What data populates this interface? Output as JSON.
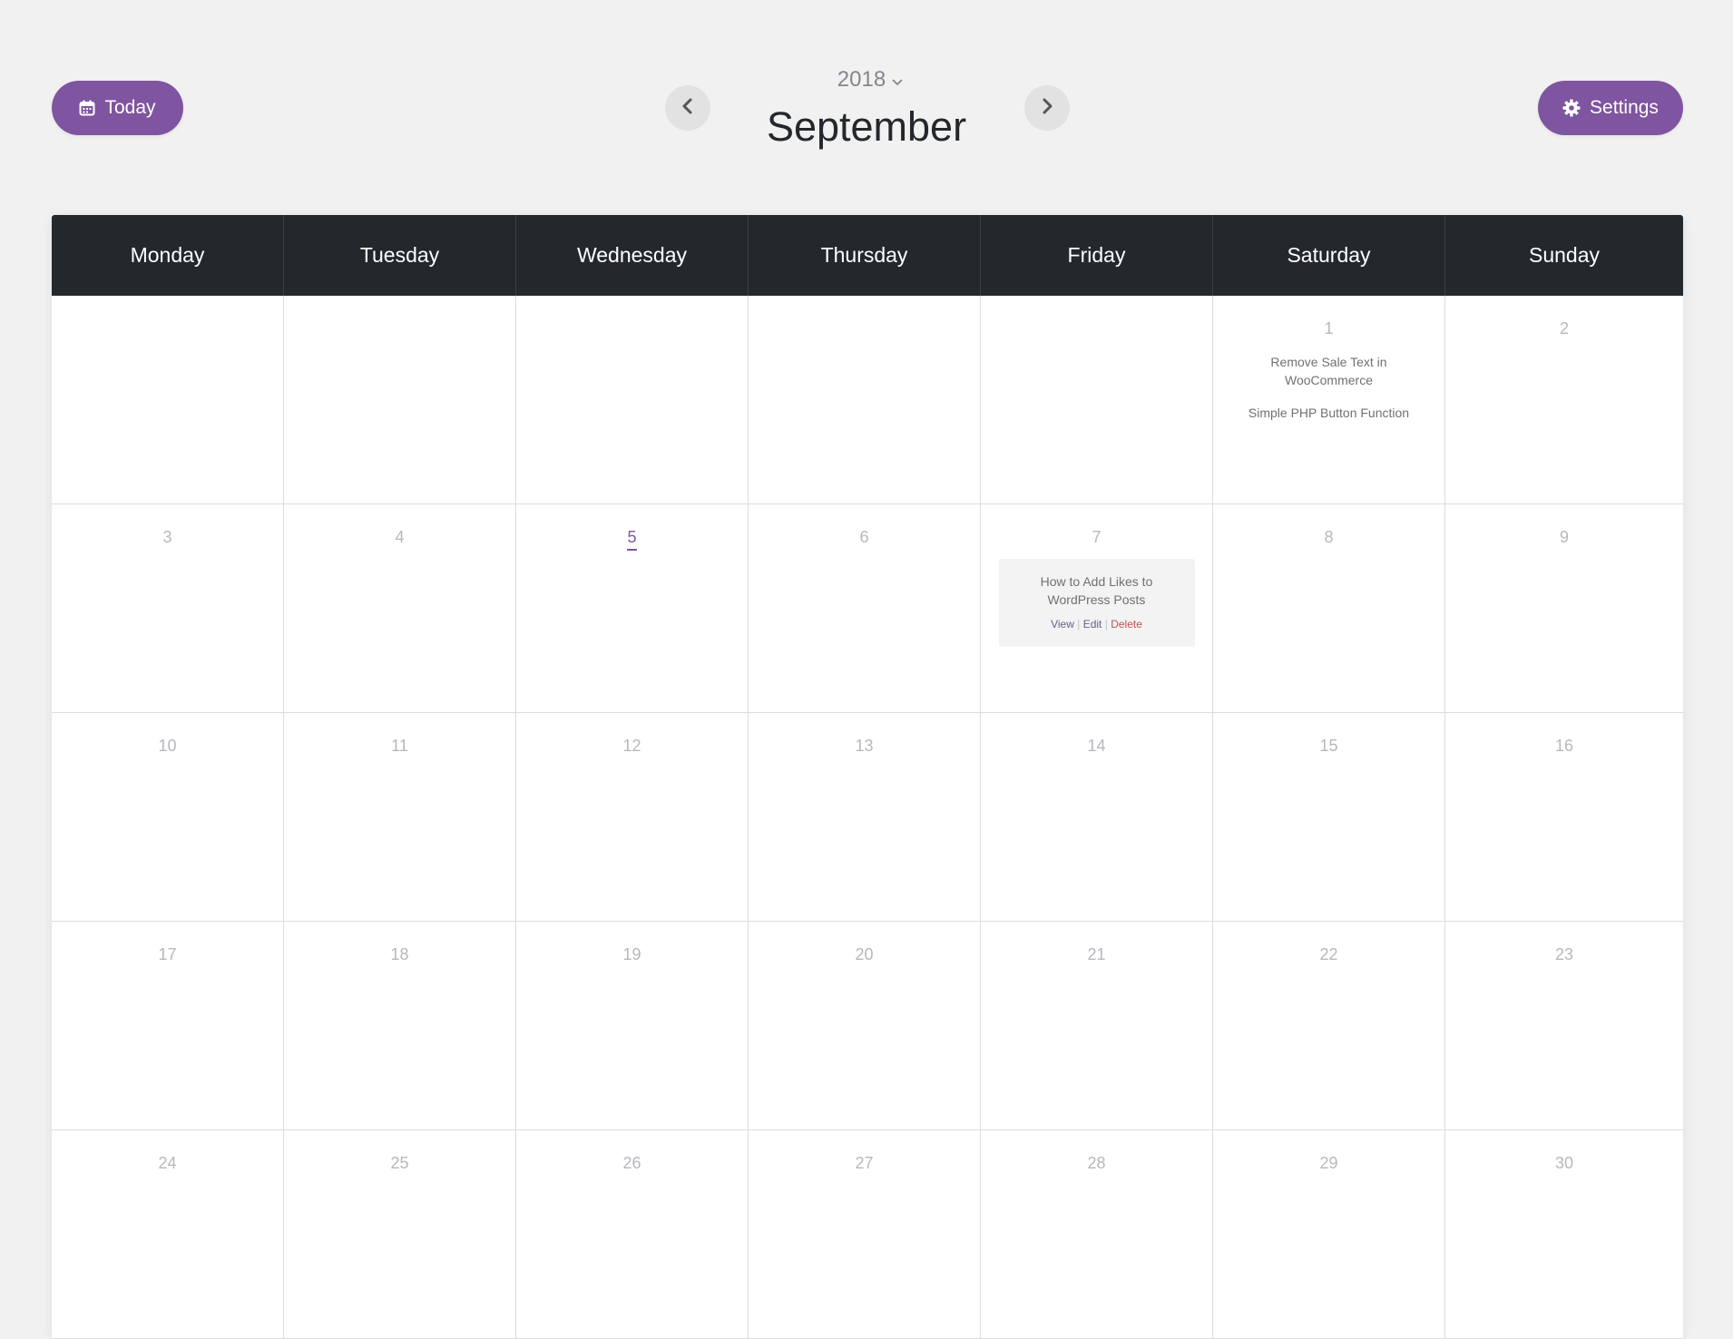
{
  "toolbar": {
    "today_label": "Today",
    "settings_label": "Settings",
    "year": "2018",
    "month": "September"
  },
  "colors": {
    "accent": "#7f54a0",
    "header_bg": "#23282d",
    "delete": "#c0504d"
  },
  "weekdays": [
    "Monday",
    "Tuesday",
    "Wednesday",
    "Thursday",
    "Friday",
    "Saturday",
    "Sunday"
  ],
  "today": 5,
  "weeks": [
    [
      "",
      "",
      "",
      "",
      "",
      "1",
      "2"
    ],
    [
      "3",
      "4",
      "5",
      "6",
      "7",
      "8",
      "9"
    ],
    [
      "10",
      "11",
      "12",
      "13",
      "14",
      "15",
      "16"
    ],
    [
      "17",
      "18",
      "19",
      "20",
      "21",
      "22",
      "23"
    ],
    [
      "24",
      "25",
      "26",
      "27",
      "28",
      "29",
      "30"
    ]
  ],
  "events": {
    "sat1_a": "Remove Sale Text in WooCommerce",
    "sat1_b": "Simple PHP Button Function",
    "fri7": {
      "title": "How to Add Likes to WordPress Posts",
      "view": "View",
      "edit": "Edit",
      "delete": "Delete",
      "sep": "|"
    }
  }
}
